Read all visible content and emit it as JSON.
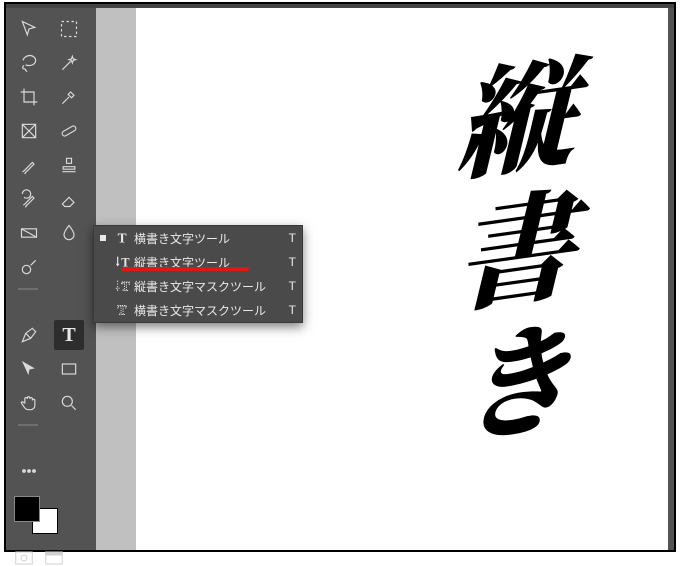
{
  "toolbar": {
    "tools": [
      {
        "name": "move-tool",
        "icon": "move"
      },
      {
        "name": "marquee-tool",
        "icon": "marquee"
      },
      {
        "name": "lasso-tool",
        "icon": "lasso"
      },
      {
        "name": "quick-select-tool",
        "icon": "wand-brush"
      },
      {
        "name": "crop-tool",
        "icon": "crop"
      },
      {
        "name": "eyedropper-tool",
        "icon": "eyedropper"
      },
      {
        "name": "frame-tool",
        "icon": "frame"
      },
      {
        "name": "healing-brush-tool",
        "icon": "bandaid"
      },
      {
        "name": "brush-tool",
        "icon": "brush"
      },
      {
        "name": "clone-stamp-tool",
        "icon": "stamp"
      },
      {
        "name": "history-brush-tool",
        "icon": "history-brush"
      },
      {
        "name": "eraser-tool",
        "icon": "eraser"
      },
      {
        "name": "gradient-tool",
        "icon": "gradient"
      },
      {
        "name": "blur-tool",
        "icon": "blur"
      },
      {
        "name": "dodge-tool",
        "icon": "dodge"
      },
      {
        "name": "pen-tool",
        "icon": "pen"
      },
      {
        "name": "type-tool",
        "icon": "type",
        "selected": true
      },
      {
        "name": "path-select-tool",
        "icon": "path-arrow"
      },
      {
        "name": "rectangle-tool",
        "icon": "rect"
      },
      {
        "name": "hand-tool",
        "icon": "hand"
      },
      {
        "name": "zoom-tool",
        "icon": "zoom"
      },
      {
        "name": "edit-toolbar",
        "icon": "dots"
      }
    ],
    "type_glyph": "T"
  },
  "flyout": {
    "items": [
      {
        "label": "横書き文字ツール",
        "shortcut": "T",
        "icon": "T-h",
        "current": true
      },
      {
        "label": "縦書き文字ツール",
        "shortcut": "T",
        "icon": "T-v",
        "current": false,
        "highlight": true
      },
      {
        "label": "縦書き文字マスクツール",
        "shortcut": "T",
        "icon": "T-v-mask",
        "current": false
      },
      {
        "label": "横書き文字マスクツール",
        "shortcut": "T",
        "icon": "T-h-mask",
        "current": false
      }
    ]
  },
  "canvas": {
    "vertical_text": "縦書き"
  }
}
